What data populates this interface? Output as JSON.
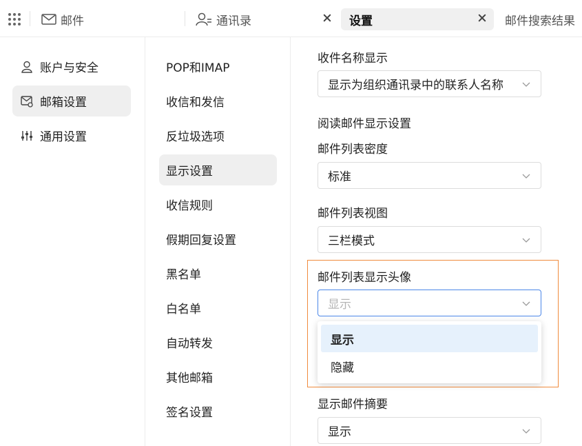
{
  "tabs": {
    "mail_label": "邮件",
    "contacts_label": "通讯录",
    "settings_label": "设置",
    "search_results_label": "邮件搜索结果"
  },
  "left_nav": {
    "items": [
      {
        "label": "账户与安全",
        "icon": "user-icon"
      },
      {
        "label": "邮箱设置",
        "icon": "mail-settings-icon",
        "active": true
      },
      {
        "label": "通用设置",
        "icon": "sliders-icon"
      }
    ]
  },
  "sub_nav": {
    "items": [
      {
        "label": "POP和IMAP"
      },
      {
        "label": "收信和发信"
      },
      {
        "label": "反垃圾选项"
      },
      {
        "label": "显示设置",
        "active": true
      },
      {
        "label": "收信规则"
      },
      {
        "label": "假期回复设置"
      },
      {
        "label": "黑名单"
      },
      {
        "label": "白名单"
      },
      {
        "label": "自动转发"
      },
      {
        "label": "其他邮箱"
      },
      {
        "label": "签名设置"
      }
    ]
  },
  "settings": {
    "recipient_name_label": "收件名称显示",
    "recipient_name_value": "显示为组织通讯录中的联系人名称",
    "reading_section_label": "阅读邮件显示设置",
    "list_density_label": "邮件列表密度",
    "list_density_value": "标准",
    "list_view_label": "邮件列表视图",
    "list_view_value": "三栏模式",
    "avatar_label": "邮件列表显示头像",
    "avatar_placeholder": "显示",
    "avatar_options": [
      "显示",
      "隐藏"
    ],
    "summary_label": "显示邮件摘要",
    "summary_value": "显示"
  },
  "colors": {
    "highlight_border": "#f08a3c",
    "selected_option_bg": "#e6f1fc",
    "focus_border": "#4a86e8"
  }
}
